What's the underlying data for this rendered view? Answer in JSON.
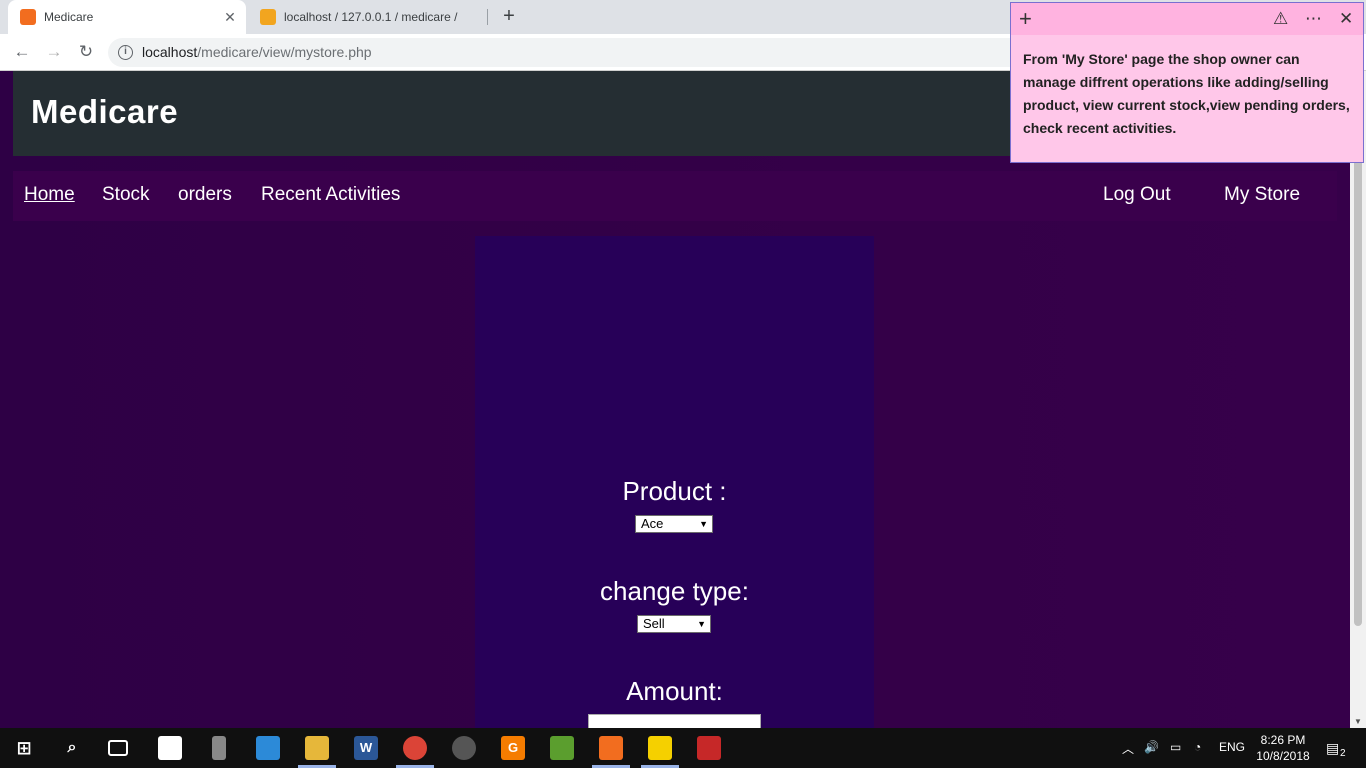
{
  "browser": {
    "tabs": [
      {
        "title": "Medicare",
        "close": "✕",
        "favicon_color": "#f26d1f"
      },
      {
        "title": "localhost / 127.0.0.1 / medicare /",
        "favicon_color": "#f2a51f"
      }
    ],
    "new_tab": "+",
    "url_host": "localhost",
    "url_path": "/medicare/view/mystore.php"
  },
  "site": {
    "title": "Medicare",
    "nav_left": [
      "Home",
      "Stock",
      "orders",
      "Recent Activities"
    ],
    "nav_right": [
      "Log Out",
      "My Store"
    ]
  },
  "form": {
    "product_label": "Product :",
    "product_selected": "Ace",
    "change_type_label": "change type:",
    "change_type_selected": "Sell",
    "amount_label": "Amount:"
  },
  "sticky_note": {
    "text": "From 'My Store' page the shop owner can manage diffrent operations like adding/selling product, view current stock,view pending orders, check recent activities."
  },
  "taskbar": {
    "language": "ENG",
    "time": "8:26 PM",
    "date": "10/8/2018",
    "notifications": "2"
  },
  "colors": {
    "header_bg": "#252e33",
    "nav_bg": "#3a004c",
    "panel_bg": "#270058",
    "page_bg": "#2e0045",
    "sticky_bg": "#ffc7e9"
  }
}
